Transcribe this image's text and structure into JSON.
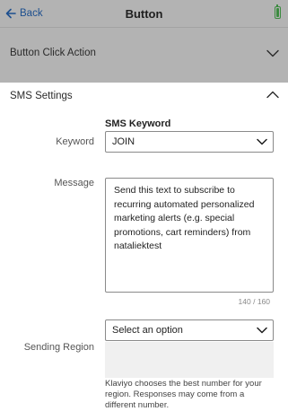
{
  "nav": {
    "back_label": "Back",
    "title": "Button"
  },
  "sections": {
    "button_click_action": "Button Click Action",
    "sms_settings": "SMS Settings"
  },
  "form": {
    "sms_keyword_heading": "SMS Keyword",
    "keyword_label": "Keyword",
    "keyword_value": "JOIN",
    "message_label": "Message",
    "message_value": "Send this text to subscribe to recurring automated personalized marketing alerts (e.g. special promotions, cart reminders) from nataliektest",
    "char_count": "140 / 160",
    "region_select_value": "Select an option",
    "sending_region_label": "Sending Region",
    "region_help": "Klaviyo chooses the best number for your region. Responses may come from a different number."
  },
  "colors": {
    "nav_background": "#b3b3b3",
    "back_link": "#1d4f8f",
    "battery": "#3b8b3f"
  }
}
